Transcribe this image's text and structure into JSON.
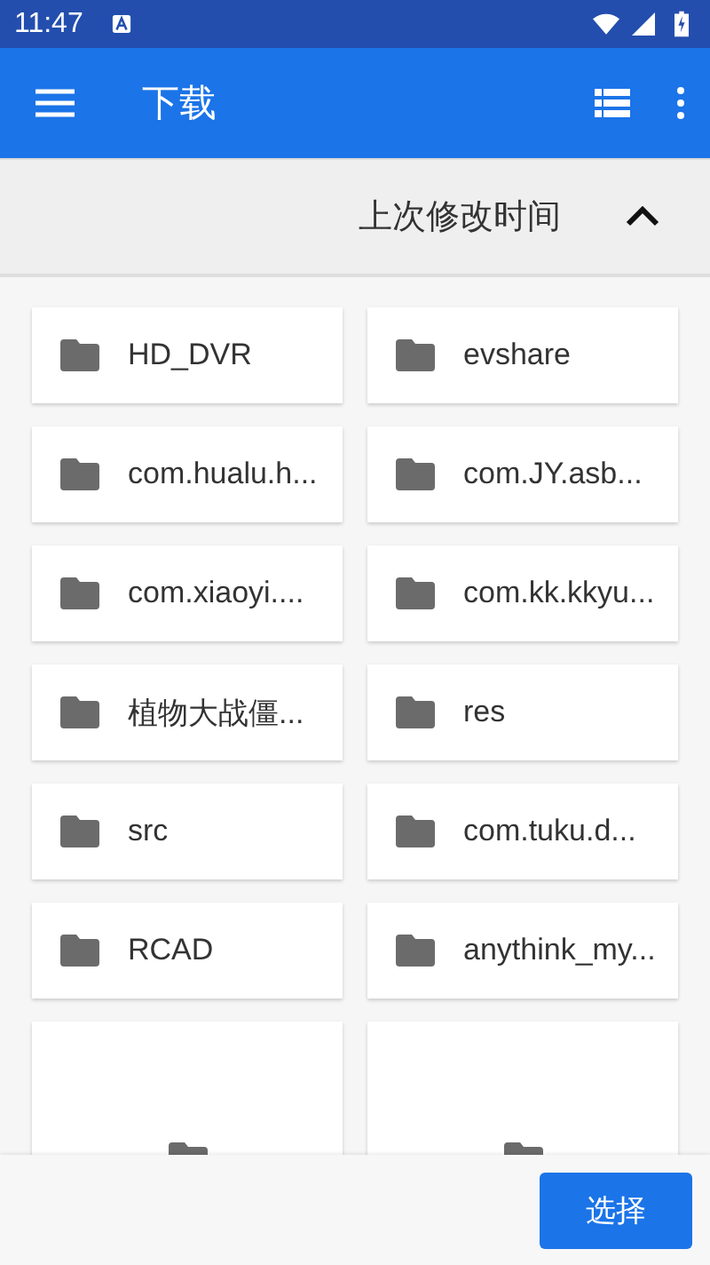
{
  "status_bar": {
    "time": "11:47"
  },
  "app_bar": {
    "title": "下载"
  },
  "sort_bar": {
    "label": "上次修改时间",
    "ascending": true
  },
  "items": [
    {
      "kind": "folder",
      "name": "HD_DVR"
    },
    {
      "kind": "folder",
      "name": "evshare"
    },
    {
      "kind": "folder",
      "name": "com.hualu.h..."
    },
    {
      "kind": "folder",
      "name": "com.JY.asb..."
    },
    {
      "kind": "folder",
      "name": "com.xiaoyi...."
    },
    {
      "kind": "folder",
      "name": "com.kk.kkyu..."
    },
    {
      "kind": "folder",
      "name": "植物大战僵..."
    },
    {
      "kind": "folder",
      "name": "res"
    },
    {
      "kind": "folder",
      "name": "src"
    },
    {
      "kind": "folder",
      "name": "com.tuku.d..."
    },
    {
      "kind": "folder",
      "name": "RCAD"
    },
    {
      "kind": "folder",
      "name": "anythink_my..."
    },
    {
      "kind": "tile"
    },
    {
      "kind": "tile"
    }
  ],
  "bottom_bar": {
    "button": "选择"
  }
}
